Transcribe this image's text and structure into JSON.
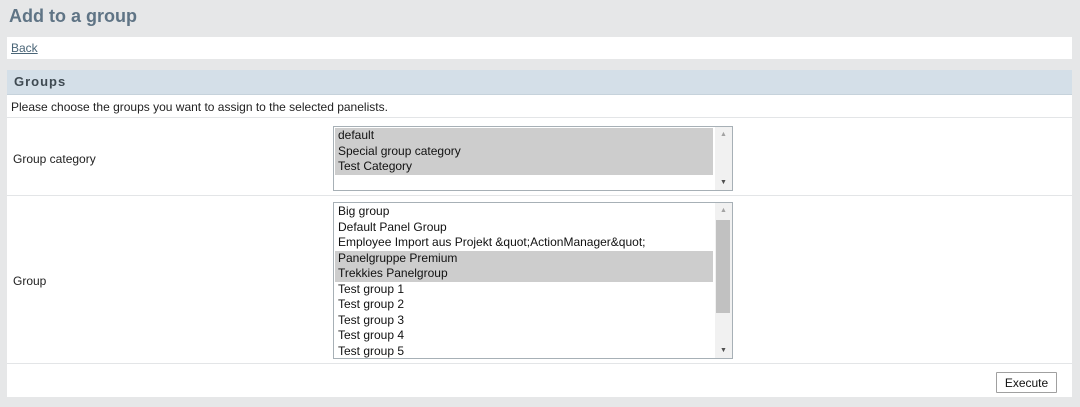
{
  "page": {
    "title": "Add to a group"
  },
  "nav": {
    "back_label": "Back"
  },
  "groups_panel": {
    "title": "Groups",
    "intro": "Please choose the groups you want to assign to the selected panelists.",
    "group_category": {
      "label": "Group category",
      "options": [
        {
          "label": "default",
          "selected": true
        },
        {
          "label": "Special group category",
          "selected": true
        },
        {
          "label": "Test Category",
          "selected": true
        }
      ]
    },
    "group": {
      "label": "Group",
      "options": [
        {
          "label": "Big group",
          "selected": false
        },
        {
          "label": "Default Panel Group",
          "selected": false
        },
        {
          "label": "Employee Import aus Projekt &quot;ActionManager&quot;",
          "selected": false
        },
        {
          "label": "Panelgruppe Premium",
          "selected": true
        },
        {
          "label": "Trekkies Panelgroup",
          "selected": true
        },
        {
          "label": "Test group 1",
          "selected": false
        },
        {
          "label": "Test group 2",
          "selected": false
        },
        {
          "label": "Test group 3",
          "selected": false
        },
        {
          "label": "Test group 4",
          "selected": false
        },
        {
          "label": "Test group 5",
          "selected": false
        }
      ]
    },
    "execute_label": "Execute"
  }
}
